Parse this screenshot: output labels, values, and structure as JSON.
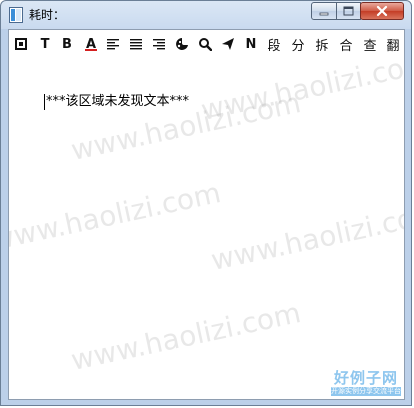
{
  "window": {
    "title": "耗时：",
    "controls": {
      "minimize": "minimize",
      "maximize": "maximize",
      "close": "close"
    }
  },
  "toolbar": {
    "buttons": [
      {
        "id": "frame",
        "icon": "frame-square-icon",
        "label": ""
      },
      {
        "id": "text",
        "icon": "",
        "label": "T"
      },
      {
        "id": "bold",
        "icon": "",
        "label": "B"
      },
      {
        "id": "color",
        "icon": "font-color-icon",
        "label": "A"
      },
      {
        "id": "align-left",
        "icon": "align-left-icon",
        "label": ""
      },
      {
        "id": "align-justify",
        "icon": "align-justify-icon",
        "label": ""
      },
      {
        "id": "align-right",
        "icon": "align-right-icon",
        "label": ""
      },
      {
        "id": "palette",
        "icon": "palette-icon",
        "label": ""
      },
      {
        "id": "search",
        "icon": "search-icon",
        "label": ""
      },
      {
        "id": "send",
        "icon": "send-icon",
        "label": ""
      },
      {
        "id": "n",
        "icon": "",
        "label": "N"
      },
      {
        "id": "segment",
        "icon": "",
        "label": "段"
      },
      {
        "id": "split",
        "icon": "",
        "label": "分"
      },
      {
        "id": "disassemble",
        "icon": "",
        "label": "拆"
      },
      {
        "id": "merge",
        "icon": "",
        "label": "合"
      },
      {
        "id": "check",
        "icon": "",
        "label": "查"
      },
      {
        "id": "translate",
        "icon": "",
        "label": "翻"
      }
    ]
  },
  "editor": {
    "content": "***该区域未发现文本***"
  },
  "watermark": {
    "text": "www.haolizi.com",
    "logo_main": "好例子网",
    "logo_sub": "开源实例分享交流平台",
    "color": "#8ec6ee"
  }
}
